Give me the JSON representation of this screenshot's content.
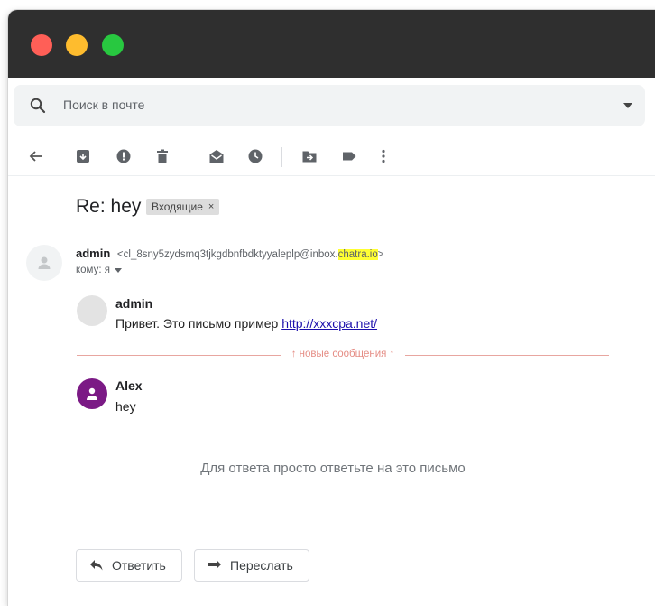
{
  "colors": {
    "titlebar": "#2f2f2f",
    "traffic_red": "#ff5f57",
    "traffic_yellow": "#febc2e",
    "traffic_green": "#28c840",
    "highlight": "#ffff33",
    "alex_avatar": "#7b1a85",
    "new_messages_divider": "#e58d85",
    "link": "#1a0dab"
  },
  "search": {
    "placeholder": "Поиск в почте",
    "icon": "search-icon",
    "dropdown_icon": "caret-down-icon"
  },
  "toolbar": {
    "icons": [
      "back-arrow-icon",
      "archive-icon",
      "report-spam-icon",
      "delete-icon",
      "mark-unread-icon",
      "snooze-icon",
      "move-to-icon",
      "label-icon",
      "more-vert-icon"
    ]
  },
  "email": {
    "subject": "Re: hey",
    "label": "Входящие",
    "label_close": "×",
    "sender_name": "admin",
    "sender_email_open": "<",
    "sender_email_local": "cl_8sny5zydsmq3tjkgdbnfbdktyyaleplp@inbox.",
    "sender_email_domain": "chatra.io",
    "sender_email_close": ">",
    "to_text": "кому: я"
  },
  "quoted": {
    "name": "admin",
    "body": "Привет. Это письмо пример ",
    "link": "http://xxxcpa.net/"
  },
  "divider": {
    "text": "↑ новые сообщения ↑"
  },
  "reply": {
    "name": "Alex",
    "body": "hey"
  },
  "footer": {
    "hint": "Для ответа просто ответьте на это письмо",
    "reply_label": "Ответить",
    "forward_label": "Переслать"
  }
}
